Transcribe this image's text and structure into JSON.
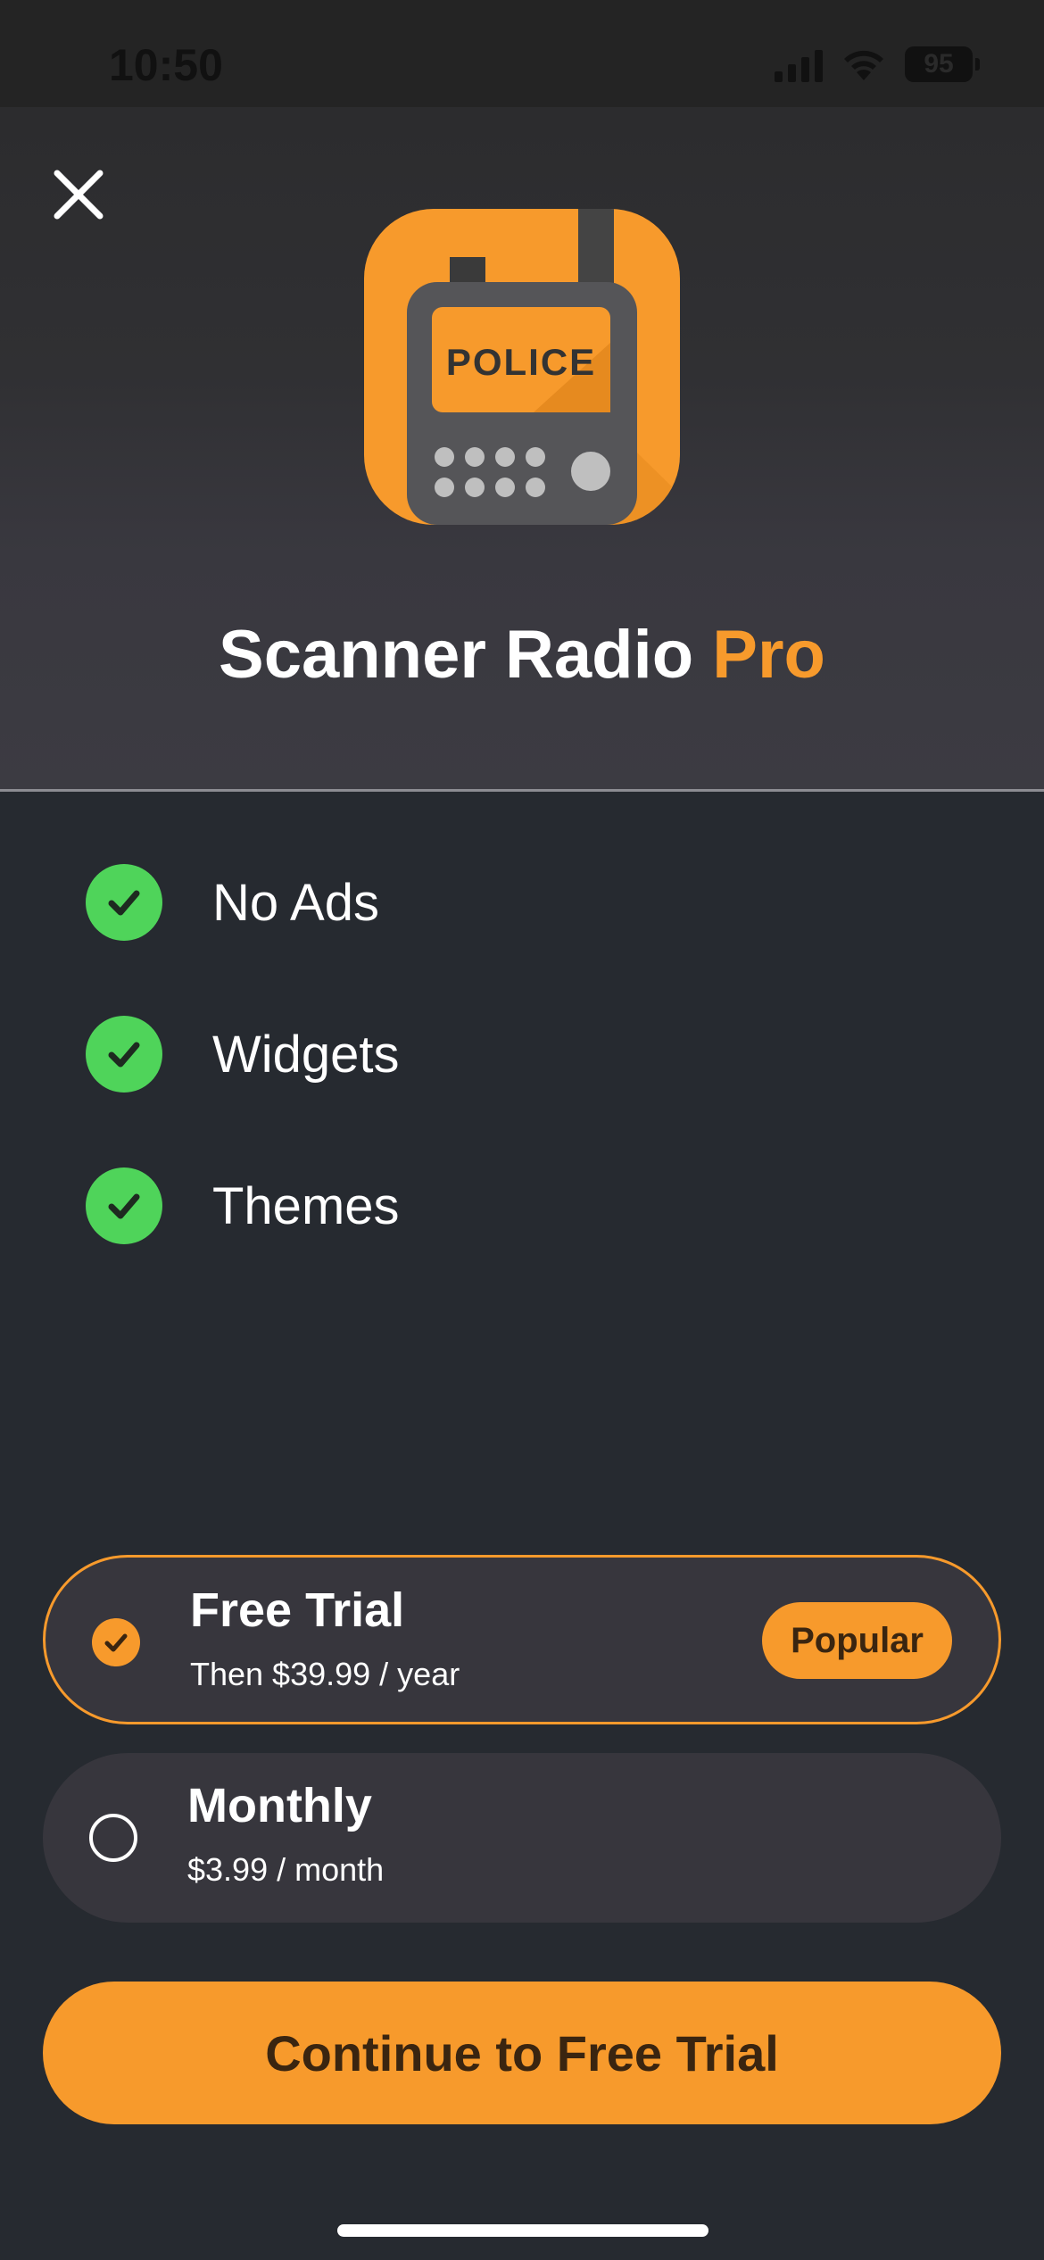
{
  "status_bar": {
    "time": "10:50",
    "battery": "95"
  },
  "header": {
    "app_icon_label": "POLICE",
    "title_main": "Scanner Radio",
    "title_accent": "Pro"
  },
  "features": [
    {
      "label": "No Ads"
    },
    {
      "label": "Widgets"
    },
    {
      "label": "Themes"
    }
  ],
  "plans": [
    {
      "name": "Free Trial",
      "subtitle": "Then $39.99 / year",
      "badge": "Popular",
      "selected": true
    },
    {
      "name": "Monthly",
      "subtitle": "$3.99 / month",
      "selected": false
    }
  ],
  "cta": {
    "label": "Continue to Free Trial"
  },
  "colors": {
    "accent": "#f79a2c",
    "check": "#4fd45a",
    "background": "#262a30",
    "card": "#37363d"
  }
}
